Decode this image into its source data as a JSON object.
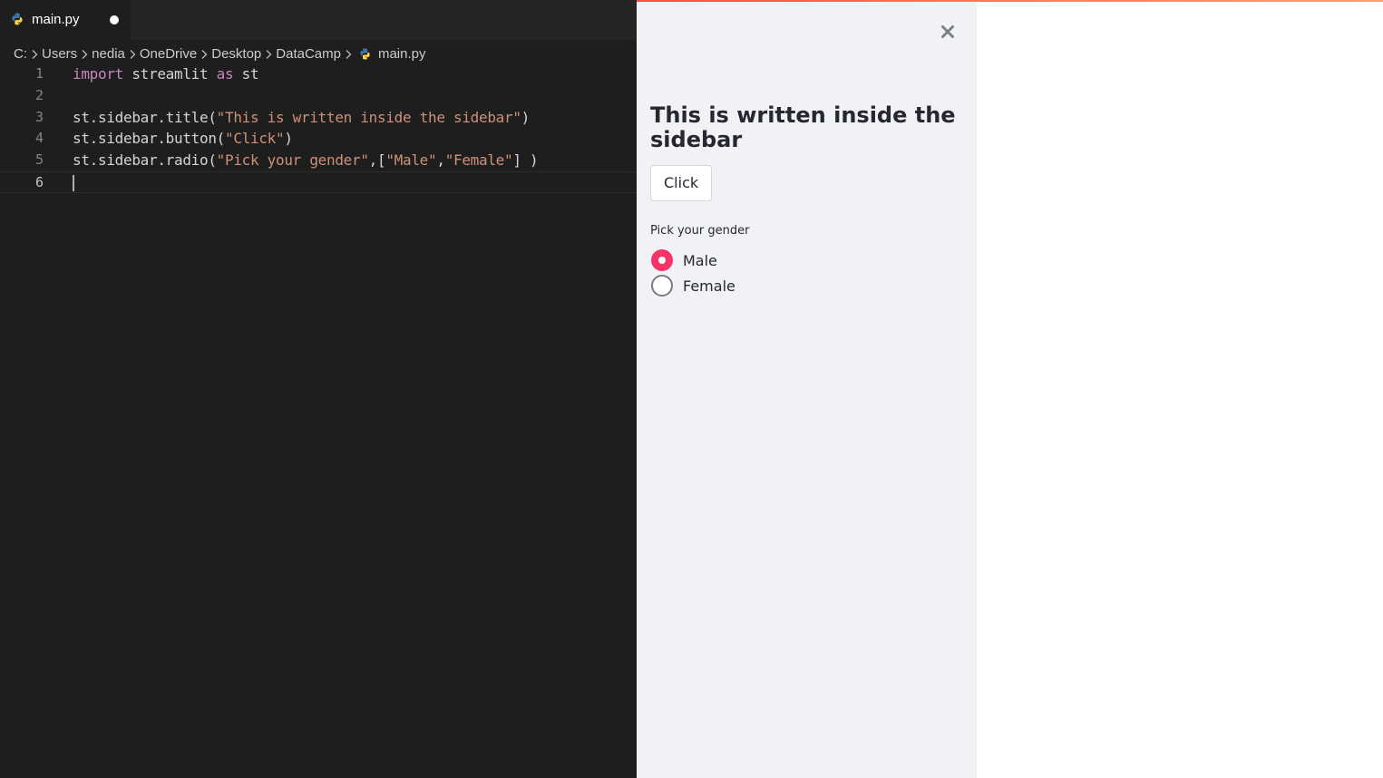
{
  "editor": {
    "tab": {
      "label": "main.py",
      "dirty": true
    },
    "breadcrumb": [
      "C:",
      "Users",
      "nedia",
      "OneDrive",
      "Desktop",
      "DataCamp",
      "main.py"
    ],
    "lines": [
      {
        "no": "1",
        "tokens": [
          {
            "t": "kw",
            "v": "import"
          },
          {
            "t": "def",
            "v": " streamlit "
          },
          {
            "t": "kw",
            "v": "as"
          },
          {
            "t": "def",
            "v": " st"
          }
        ]
      },
      {
        "no": "2",
        "tokens": []
      },
      {
        "no": "3",
        "tokens": [
          {
            "t": "def",
            "v": "st.sidebar.title("
          },
          {
            "t": "str",
            "v": "\"This is written inside the sidebar\""
          },
          {
            "t": "def",
            "v": ")"
          }
        ]
      },
      {
        "no": "4",
        "tokens": [
          {
            "t": "def",
            "v": "st.sidebar.button("
          },
          {
            "t": "str",
            "v": "\"Click\""
          },
          {
            "t": "def",
            "v": ")"
          }
        ]
      },
      {
        "no": "5",
        "tokens": [
          {
            "t": "def",
            "v": "st.sidebar.radio("
          },
          {
            "t": "str",
            "v": "\"Pick your gender\""
          },
          {
            "t": "def",
            "v": ",["
          },
          {
            "t": "str",
            "v": "\"Male\""
          },
          {
            "t": "def",
            "v": ","
          },
          {
            "t": "str",
            "v": "\"Female\""
          },
          {
            "t": "def",
            "v": "] )"
          }
        ]
      },
      {
        "no": "6",
        "tokens": [],
        "current": true
      }
    ],
    "colors": {
      "background": "#1e1e1e",
      "keyword": "#c586c0",
      "string": "#ce9178",
      "default": "#d4d4d4"
    }
  },
  "app": {
    "sidebar": {
      "title": "This is written inside the sidebar",
      "button_label": "Click",
      "radio": {
        "label": "Pick your gender",
        "options": [
          "Male",
          "Female"
        ],
        "selected": "Male"
      }
    },
    "colors": {
      "sidebar_bg": "#f0f2f6",
      "accent": "#f63366",
      "text": "#262730"
    }
  }
}
